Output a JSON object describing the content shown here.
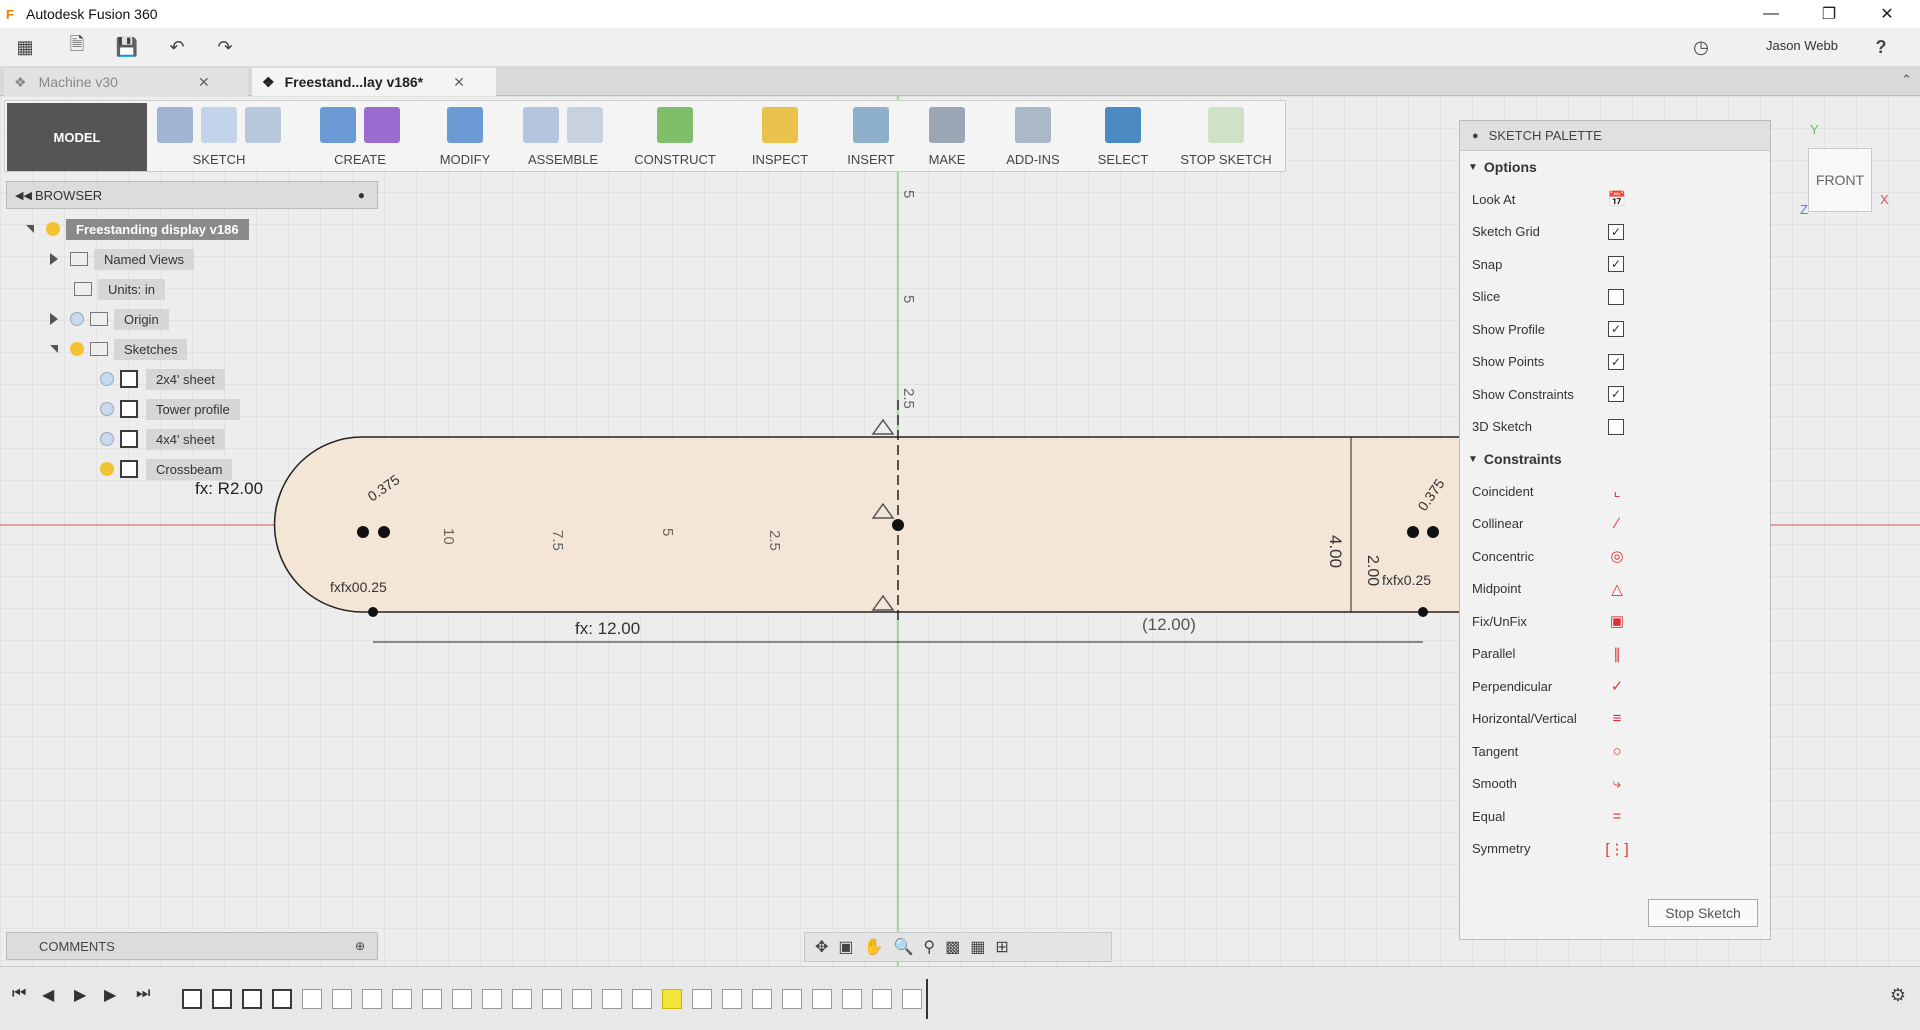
{
  "window": {
    "title": "Autodesk Fusion 360",
    "app_icon": "F"
  },
  "user": {
    "name": "Jason Webb",
    "help": "?"
  },
  "tabs": [
    {
      "label": "Machine v30"
    },
    {
      "label": "Freestand...lay v186*"
    }
  ],
  "ribbon": {
    "workspace": "MODEL",
    "groups": [
      "SKETCH",
      "CREATE",
      "MODIFY",
      "ASSEMBLE",
      "CONSTRUCT",
      "INSPECT",
      "INSERT",
      "MAKE",
      "ADD-INS",
      "SELECT",
      "STOP SKETCH"
    ]
  },
  "browser": {
    "title": "BROWSER",
    "root": "Freestanding display v186",
    "named_views": "Named Views",
    "units": "Units: in",
    "origin": "Origin",
    "sketches": "Sketches",
    "sketch_items": [
      "2x4' sheet",
      "Tower profile",
      "4x4' sheet",
      "Crossbeam"
    ]
  },
  "palette": {
    "title": "SKETCH PALETTE",
    "options_title": "Options",
    "options": [
      {
        "label": "Look At",
        "type": "button"
      },
      {
        "label": "Sketch Grid",
        "checked": true
      },
      {
        "label": "Snap",
        "checked": true
      },
      {
        "label": "Slice",
        "checked": false
      },
      {
        "label": "Show Profile",
        "checked": true
      },
      {
        "label": "Show Points",
        "checked": true
      },
      {
        "label": "Show Constraints",
        "checked": true
      },
      {
        "label": "3D Sketch",
        "checked": false
      }
    ],
    "constraints_title": "Constraints",
    "constraints": [
      "Coincident",
      "Collinear",
      "Concentric",
      "Midpoint",
      "Fix/UnFix",
      "Parallel",
      "Perpendicular",
      "Horizontal/Vertical",
      "Tangent",
      "Smooth",
      "Equal",
      "Symmetry"
    ],
    "stop_button": "Stop Sketch"
  },
  "viewcube": {
    "face": "FRONT",
    "x": "X",
    "y": "Y",
    "z": "Z"
  },
  "comments": {
    "label": "COMMENTS"
  },
  "sketch": {
    "radius_label": "fx: R2.00",
    "width_left": "fx: 12.00",
    "width_right": "(12.00)",
    "height": "4.00",
    "inner_height": "2.00",
    "axis_ticks": [
      "5",
      "5",
      "2.5",
      "10",
      "7.5",
      "5",
      "2.5"
    ],
    "small_labels": [
      "0.375",
      "fxfx00.25",
      "fxfx0.25",
      "0.375"
    ]
  },
  "colors": {
    "profile_fill": "#f4e6d6",
    "accent": "#4a8ac0",
    "axis_red": "#e05050",
    "axis_green": "#5cc05c"
  }
}
